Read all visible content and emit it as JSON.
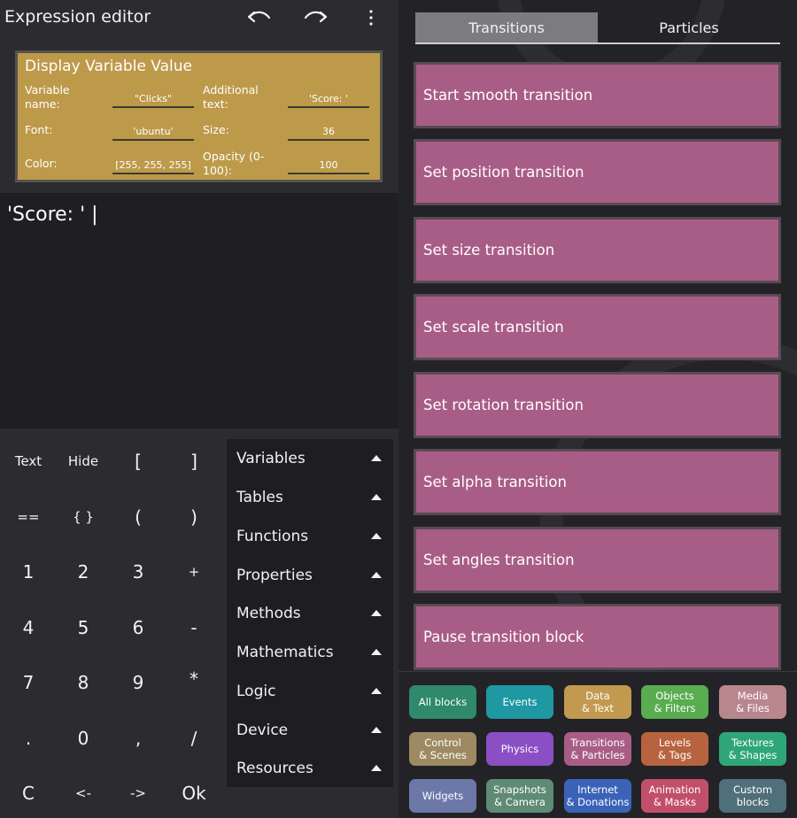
{
  "topbar": {
    "title": "Expression editor",
    "undo_icon": "undo-icon",
    "redo_icon": "redo-icon",
    "more_icon": "more-vertical-icon"
  },
  "block": {
    "title": "Display Variable Value",
    "params": {
      "variable_name": {
        "label": "Variable name:",
        "value": "\"Clicks\""
      },
      "additional_text": {
        "label": "Additional text:",
        "value": "'Score: '"
      },
      "font": {
        "label": "Font:",
        "value": "'ubuntu'"
      },
      "size": {
        "label": "Size:",
        "value": "36"
      },
      "color": {
        "label": "Color:",
        "value": "[255, 255, 255]"
      },
      "opacity": {
        "label": "Opacity (0-100):",
        "value": "100"
      }
    },
    "color": "#bd9a4a"
  },
  "editor": {
    "text": "'Score: ' |"
  },
  "keypad": {
    "rows": [
      [
        "Text",
        "Hide",
        "[",
        "]"
      ],
      [
        "==",
        "{ }",
        "(",
        ")"
      ],
      [
        "1",
        "2",
        "3",
        "+"
      ],
      [
        "4",
        "5",
        "6",
        "-"
      ],
      [
        "7",
        "8",
        "9",
        "*"
      ],
      [
        ".",
        "0",
        ",",
        "/"
      ],
      [
        "C",
        "<-",
        "->",
        "Ok"
      ]
    ]
  },
  "categories": [
    "Variables",
    "Tables",
    "Functions",
    "Properties",
    "Methods",
    "Mathematics",
    "Logic",
    "Device",
    "Resources"
  ],
  "tabs": {
    "transitions": "Transitions",
    "particles": "Particles",
    "active": "Transitions"
  },
  "transition_blocks": [
    "Start smooth transition",
    "Set position transition",
    "Set size transition",
    "Set scale transition",
    "Set rotation transition",
    "Set alpha transition",
    "Set angles transition",
    "Pause transition block"
  ],
  "palette": [
    {
      "label": "All blocks",
      "color": "#2e8a6b"
    },
    {
      "label": "Events",
      "color": "#1f98a3"
    },
    {
      "label": "Data\n& Text",
      "color": "#c29a4f"
    },
    {
      "label": "Objects\n& Filters",
      "color": "#59ac4f"
    },
    {
      "label": "Media\n& Files",
      "color": "#b8878d"
    },
    {
      "label": "Control\n& Scenes",
      "color": "#9e8a62"
    },
    {
      "label": "Physics",
      "color": "#8b4fc4"
    },
    {
      "label": "Transitions\n& Particles",
      "color": "#a85d86"
    },
    {
      "label": "Levels\n& Tags",
      "color": "#b7633f"
    },
    {
      "label": "Textures\n& Shapes",
      "color": "#2fa67a"
    },
    {
      "label": "Widgets",
      "color": "#6c78a8"
    },
    {
      "label": "Snapshots\n& Camera",
      "color": "#5f8a74"
    },
    {
      "label": "Internet\n& Donations",
      "color": "#3a63b8"
    },
    {
      "label": "Animation\n& Masks",
      "color": "#c24f69"
    },
    {
      "label": "Custom\nblocks",
      "color": "#4f6f7a"
    }
  ]
}
